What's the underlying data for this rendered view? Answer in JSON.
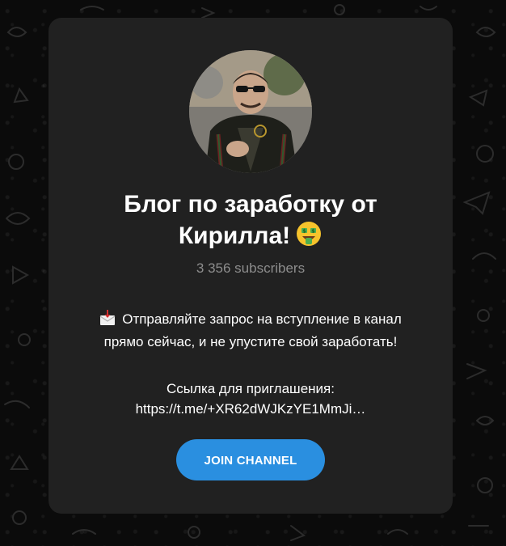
{
  "channel": {
    "title_line1": "Блог по заработку от",
    "title_line2": "Кирилла!",
    "subscribers": "3 356 subscribers",
    "description_line1": "Отправляйте запрос на вступление в канал",
    "description_line2": "прямо сейчас, и не упустите свой заработать!",
    "invite_label": "Ссылка для приглашения:",
    "invite_link": "https://t.me/+XR62dWJKzYE1MmJi…"
  },
  "actions": {
    "join_label": "JOIN CHANNEL"
  },
  "icons": {
    "title_emoji": "money-mouth-face-icon",
    "description_emoji": "envelope-with-arrow-icon"
  },
  "colors": {
    "background": "#0b0b0b",
    "card": "#212121",
    "accent": "#2a8fe0",
    "muted_text": "#8d8d8d"
  }
}
